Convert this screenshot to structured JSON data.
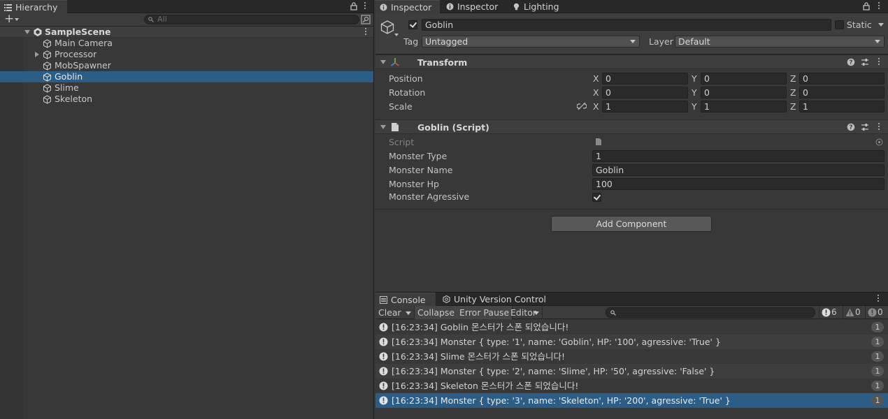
{
  "hierarchy": {
    "tab_label": "Hierarchy",
    "add_label": "+",
    "search_placeholder": "All",
    "scene": "SampleScene",
    "items": [
      {
        "label": "Main Camera"
      },
      {
        "label": "Processor"
      },
      {
        "label": "MobSpawner"
      },
      {
        "label": "Goblin"
      },
      {
        "label": "Slime"
      },
      {
        "label": "Skeleton"
      }
    ]
  },
  "inspector": {
    "tabs": [
      {
        "label": "Inspector"
      },
      {
        "label": "Inspector"
      },
      {
        "label": "Lighting"
      }
    ],
    "object_name": "Goblin",
    "static_label": "Static",
    "tag_label": "Tag",
    "tag_value": "Untagged",
    "layer_label": "Layer",
    "layer_value": "Default",
    "transform": {
      "title": "Transform",
      "rows": [
        {
          "label": "Position",
          "x": "0",
          "y": "0",
          "z": "0"
        },
        {
          "label": "Rotation",
          "x": "0",
          "y": "0",
          "z": "0"
        },
        {
          "label": "Scale",
          "x": "1",
          "y": "1",
          "z": "1"
        }
      ],
      "axis_x": "X",
      "axis_y": "Y",
      "axis_z": "Z"
    },
    "script": {
      "title": "Goblin (Script)",
      "script_label": "Script",
      "monster_type_label": "Monster Type",
      "monster_type": "1",
      "monster_name_label": "Monster Name",
      "monster_name": "Goblin",
      "monster_hp_label": "Monster Hp",
      "monster_hp": "100",
      "monster_agressive_label": "Monster Agressive"
    },
    "add_component": "Add Component"
  },
  "console": {
    "tabs": [
      {
        "label": "Console"
      },
      {
        "label": "Unity Version Control"
      }
    ],
    "clear": "Clear",
    "collapse": "Collapse",
    "error_pause": "Error Pause",
    "editor": "Editor",
    "count_info": "6",
    "count_warn": "0",
    "count_error": "0",
    "logs": [
      {
        "text": "[16:23:34] Goblin 몬스터가 스폰 되었습니다!",
        "count": "1"
      },
      {
        "text": "[16:23:34] Monster { type: '1', name: 'Goblin', HP: '100', agressive: 'True' }",
        "count": "1"
      },
      {
        "text": "[16:23:34] Slime 몬스터가 스폰 되었습니다!",
        "count": "1"
      },
      {
        "text": "[16:23:34] Monster { type: '2', name: 'Slime', HP: '50', agressive: 'False' }",
        "count": "1"
      },
      {
        "text": "[16:23:34] Skeleton 몬스터가 스폰 되었습니다!",
        "count": "1"
      },
      {
        "text": "[16:23:34] Monster { type: '3', name: 'Skeleton', HP: '200', agressive: 'True' }",
        "count": "1"
      }
    ]
  },
  "colors": {
    "selection": "#2c5d87",
    "panel": "#383838",
    "tabbar": "#282828"
  }
}
